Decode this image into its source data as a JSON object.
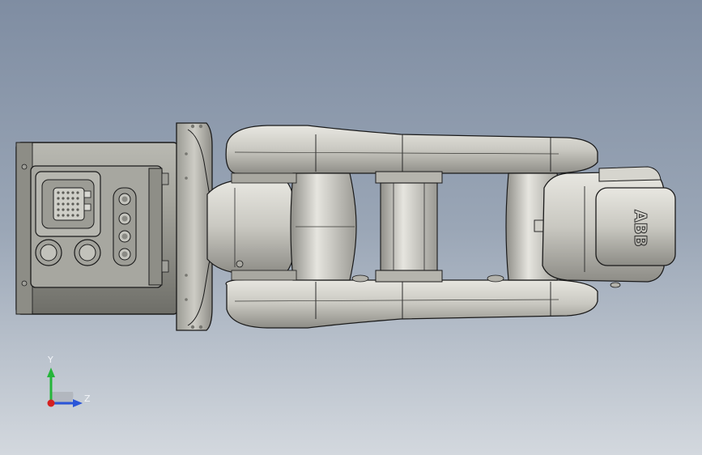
{
  "viewport": {
    "background_top": "#7f8da2",
    "background_bottom": "#d3d8de"
  },
  "model": {
    "logo_text": "ABB",
    "body_color": "#c8c7c0",
    "base_color": "#8e8e86",
    "edge_color": "#1a1a1a"
  },
  "triad": {
    "y_label": "Y",
    "z_label": "Z",
    "y_color": "#25b53a",
    "z_color": "#2a55d8",
    "origin_color": "#d42020"
  }
}
